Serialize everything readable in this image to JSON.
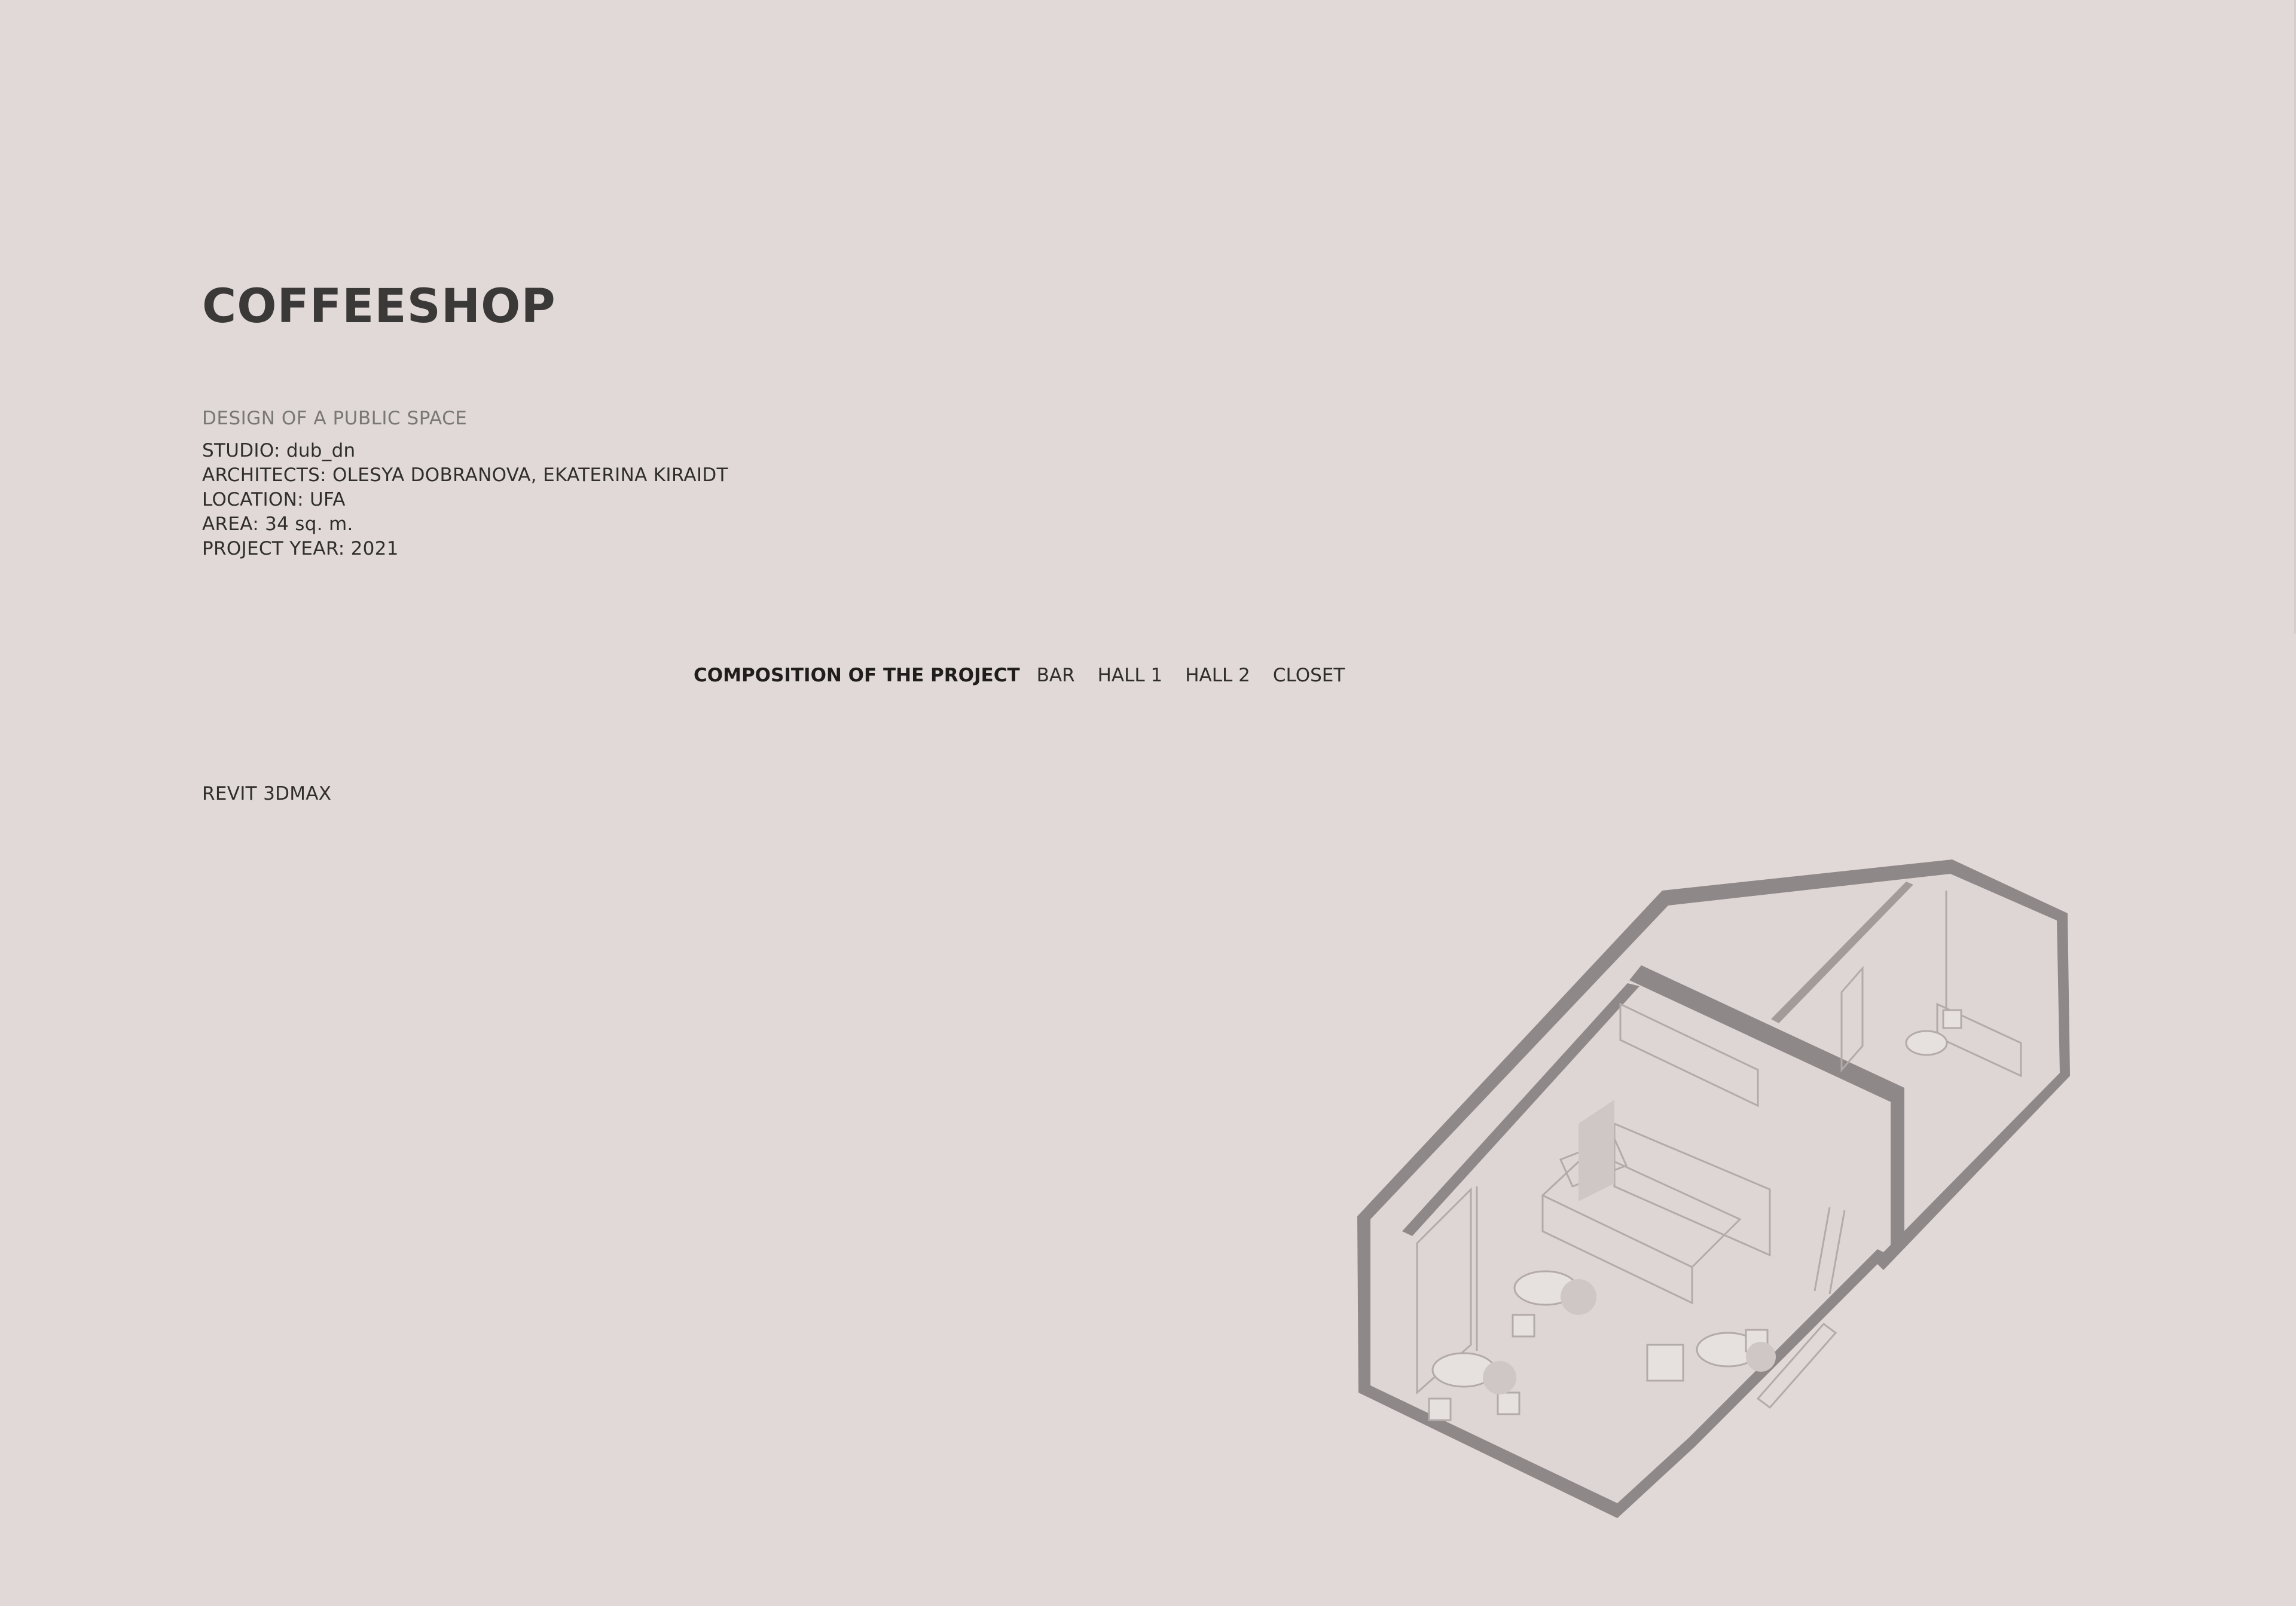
{
  "header": {
    "title": "COFFEESHOP",
    "subtitle": "DESIGN OF A PUBLIC SPACE"
  },
  "project_info": {
    "studio": "STUDIO: dub_dn",
    "architects": "ARCHITECTS: OLESYA DOBRANOVA, EKATERINA KIRAIDT",
    "location": "LOCATION: UFA",
    "area": "AREA: 34 sq. m.",
    "year": "PROJECT YEAR: 2021"
  },
  "composition": {
    "heading": "COMPOSITION OF THE PROJECT",
    "items": [
      "BAR",
      "HALL 1",
      "HALL 2",
      "CLOSET"
    ]
  },
  "software": "REVIT 3DMAX",
  "colors": {
    "background": "#e1d9d7",
    "wall": "#8f8888",
    "interior": "#ddd6d4",
    "line": "#b3abaa"
  }
}
